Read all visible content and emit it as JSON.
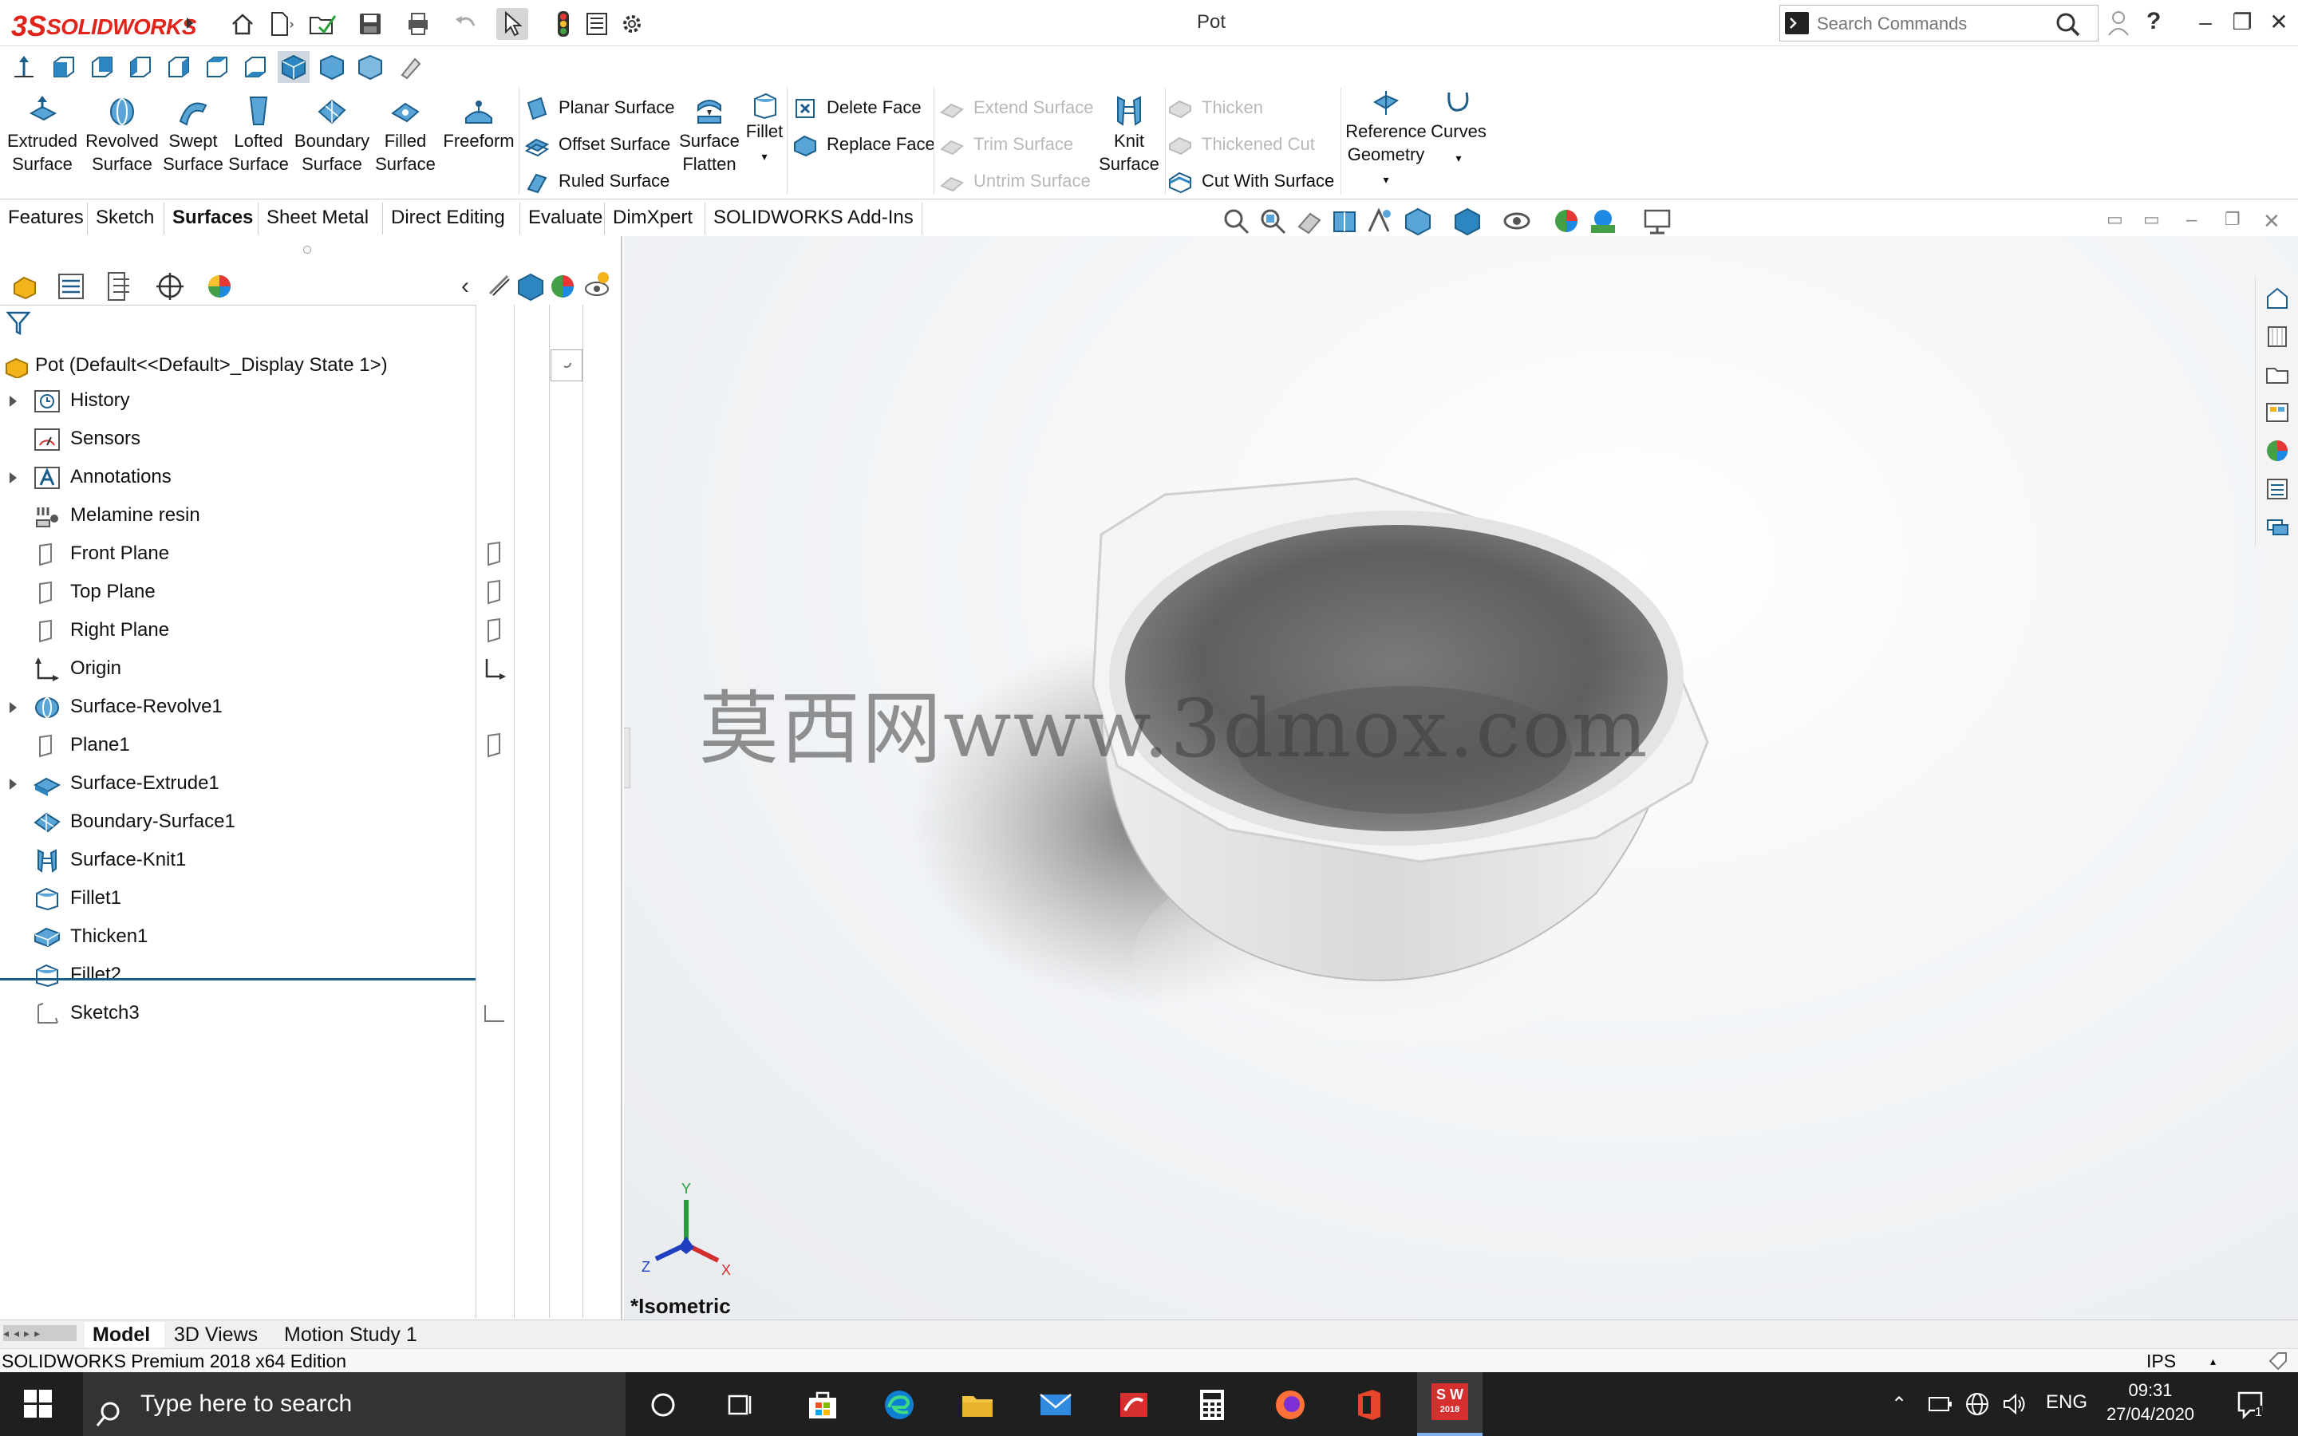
{
  "app": {
    "brand_ds": "3S",
    "brand_name": "SOLIDWORKS",
    "document_title": "Pot"
  },
  "search": {
    "placeholder": "Search Commands"
  },
  "ribbon": {
    "big_buttons": [
      {
        "label1": "Extruded",
        "label2": "Surface",
        "icon": "extruded-surface-icon"
      },
      {
        "label1": "Revolved",
        "label2": "Surface",
        "icon": "revolved-surface-icon"
      },
      {
        "label1": "Swept",
        "label2": "Surface",
        "icon": "swept-surface-icon"
      },
      {
        "label1": "Lofted",
        "label2": "Surface",
        "icon": "lofted-surface-icon"
      },
      {
        "label1": "Boundary",
        "label2": "Surface",
        "icon": "boundary-surface-icon"
      },
      {
        "label1": "Filled",
        "label2": "Surface",
        "icon": "filled-surface-icon"
      },
      {
        "label1": "Freeform",
        "label2": "",
        "icon": "freeform-icon"
      }
    ],
    "col1": [
      "Planar Surface",
      "Offset Surface",
      "Ruled Surface"
    ],
    "surface_flatten": {
      "label1": "Surface",
      "label2": "Flatten"
    },
    "fillet": "Fillet",
    "col2": [
      "Delete Face",
      "Replace Face"
    ],
    "col3_disabled": [
      "Extend Surface",
      "Trim Surface",
      "Untrim Surface"
    ],
    "knit": {
      "label1": "Knit",
      "label2": "Surface"
    },
    "col4": [
      {
        "label": "Thicken",
        "disabled": true
      },
      {
        "label": "Thickened Cut",
        "disabled": true
      },
      {
        "label": "Cut With Surface",
        "disabled": false
      }
    ],
    "ref_geometry": {
      "label1": "Reference",
      "label2": "Geometry"
    },
    "curves": "Curves"
  },
  "tabs": [
    "Features",
    "Sketch",
    "Surfaces",
    "Sheet Metal",
    "Direct Editing",
    "Evaluate",
    "DimXpert",
    "SOLIDWORKS Add-Ins"
  ],
  "active_tab": "Surfaces",
  "tree": {
    "root": "Pot  (Default<<Default>_Display State 1>)",
    "items": [
      {
        "label": "History",
        "expandable": true,
        "icon": "history-icon"
      },
      {
        "label": "Sensors",
        "expandable": false,
        "icon": "sensors-icon"
      },
      {
        "label": "Annotations",
        "expandable": true,
        "icon": "annotations-icon"
      },
      {
        "label": "Melamine resin",
        "expandable": false,
        "icon": "material-icon"
      },
      {
        "label": "Front Plane",
        "expandable": false,
        "icon": "plane-icon"
      },
      {
        "label": "Top Plane",
        "expandable": false,
        "icon": "plane-icon"
      },
      {
        "label": "Right Plane",
        "expandable": false,
        "icon": "plane-icon"
      },
      {
        "label": "Origin",
        "expandable": false,
        "icon": "origin-icon"
      },
      {
        "label": "Surface-Revolve1",
        "expandable": true,
        "icon": "revolve-feature-icon"
      },
      {
        "label": "Plane1",
        "expandable": false,
        "icon": "plane-icon"
      },
      {
        "label": "Surface-Extrude1",
        "expandable": true,
        "icon": "extrude-feature-icon"
      },
      {
        "label": "Boundary-Surface1",
        "expandable": false,
        "icon": "boundary-feature-icon"
      },
      {
        "label": "Surface-Knit1",
        "expandable": false,
        "icon": "knit-feature-icon"
      },
      {
        "label": "Fillet1",
        "expandable": false,
        "icon": "fillet-feature-icon"
      },
      {
        "label": "Thicken1",
        "expandable": false,
        "icon": "thicken-feature-icon"
      },
      {
        "label": "Fillet2",
        "expandable": false,
        "icon": "fillet-feature-icon"
      },
      {
        "label": "Sketch3",
        "expandable": false,
        "icon": "sketch-icon"
      }
    ]
  },
  "viewport": {
    "view_label": "*Isometric",
    "watermark": "莫西网www.3dmox.com",
    "triad": {
      "x": "X",
      "y": "Y",
      "z": "Z"
    }
  },
  "bottom_tabs": [
    "Model",
    "3D Views",
    "Motion Study 1"
  ],
  "active_bottom_tab": "Model",
  "status": {
    "edition": "SOLIDWORKS Premium 2018 x64 Edition",
    "units": "IPS"
  },
  "taskbar": {
    "search_placeholder": "Type here to search",
    "language": "ENG",
    "time": "09:31",
    "date": "27/04/2020",
    "sw_badge": "S W",
    "sw_year": "2018",
    "notifications": "1"
  },
  "colors": {
    "accent_blue": "#1b7bbf",
    "brand_red": "#e2231a",
    "taskbar_bg": "#1f1f1f"
  }
}
